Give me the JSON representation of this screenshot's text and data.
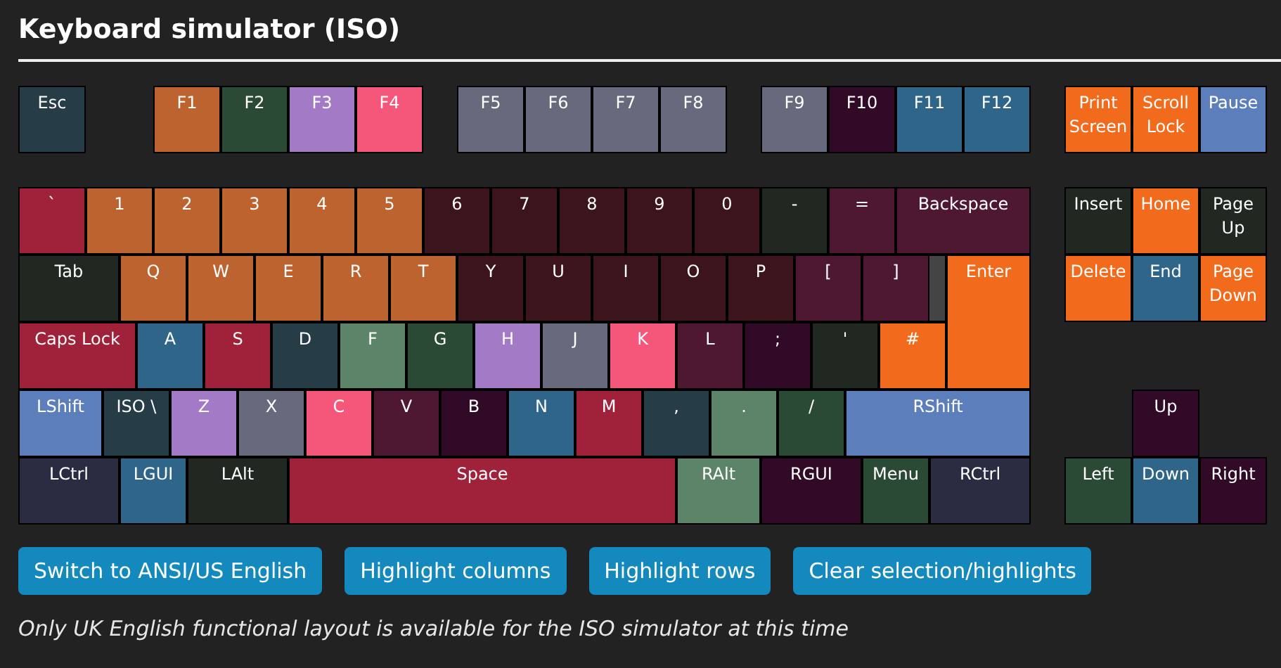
{
  "title": "Keyboard simulator (ISO)",
  "function_keys": [
    {
      "label": "Esc",
      "color": "#263c47"
    },
    {
      "label": "F1",
      "color": "#bc6330"
    },
    {
      "label": "F2",
      "color": "#2b4a36"
    },
    {
      "label": "F3",
      "color": "#a27ac6"
    },
    {
      "label": "F4",
      "color": "#f5577b"
    },
    {
      "label": "F5",
      "color": "#666a7c"
    },
    {
      "label": "F6",
      "color": "#666a7c"
    },
    {
      "label": "F7",
      "color": "#666a7c"
    },
    {
      "label": "F8",
      "color": "#666a7c"
    },
    {
      "label": "F9",
      "color": "#666a7c"
    },
    {
      "label": "F10",
      "color": "#300a26"
    },
    {
      "label": "F11",
      "color": "#30658a"
    },
    {
      "label": "F12",
      "color": "#30658a"
    },
    {
      "label": "Print Screen",
      "color": "#f26b1d"
    },
    {
      "label": "Scroll Lock",
      "color": "#f26b1d"
    },
    {
      "label": "Pause",
      "color": "#5c7fbb"
    }
  ],
  "main_rows": [
    [
      {
        "label": "`",
        "color": "#a0213a"
      },
      {
        "label": "1",
        "color": "#bc6330"
      },
      {
        "label": "2",
        "color": "#bc6330"
      },
      {
        "label": "3",
        "color": "#bc6330"
      },
      {
        "label": "4",
        "color": "#bc6330"
      },
      {
        "label": "5",
        "color": "#bc6330"
      },
      {
        "label": "6",
        "color": "#3b151b"
      },
      {
        "label": "7",
        "color": "#3b151b"
      },
      {
        "label": "8",
        "color": "#3b151b"
      },
      {
        "label": "9",
        "color": "#3b151b"
      },
      {
        "label": "0",
        "color": "#3b151b"
      },
      {
        "label": "-",
        "color": "#212821"
      },
      {
        "label": "=",
        "color": "#4e1833"
      },
      {
        "label": "Backspace",
        "color": "#4e1833"
      }
    ],
    [
      {
        "label": "Tab",
        "color": "#212821"
      },
      {
        "label": "Q",
        "color": "#bc6330"
      },
      {
        "label": "W",
        "color": "#bc6330"
      },
      {
        "label": "E",
        "color": "#bc6330"
      },
      {
        "label": "R",
        "color": "#bc6330"
      },
      {
        "label": "T",
        "color": "#bc6330"
      },
      {
        "label": "Y",
        "color": "#3b151b"
      },
      {
        "label": "U",
        "color": "#3b151b"
      },
      {
        "label": "I",
        "color": "#3b151b"
      },
      {
        "label": "O",
        "color": "#3b151b"
      },
      {
        "label": "P",
        "color": "#3b151b"
      },
      {
        "label": "[",
        "color": "#4e1833"
      },
      {
        "label": "]",
        "color": "#4e1833"
      },
      {
        "label": "Enter",
        "color": "#f26b1d"
      }
    ],
    [
      {
        "label": "Caps Lock",
        "color": "#a0213a"
      },
      {
        "label": "A",
        "color": "#30658a"
      },
      {
        "label": "S",
        "color": "#a0213a"
      },
      {
        "label": "D",
        "color": "#263c47"
      },
      {
        "label": "F",
        "color": "#5b8468"
      },
      {
        "label": "G",
        "color": "#2b4a36"
      },
      {
        "label": "H",
        "color": "#a27ac6"
      },
      {
        "label": "J",
        "color": "#666a7c"
      },
      {
        "label": "K",
        "color": "#f5577b"
      },
      {
        "label": "L",
        "color": "#4e1833"
      },
      {
        "label": ";",
        "color": "#300a26"
      },
      {
        "label": "'",
        "color": "#212821"
      },
      {
        "label": "#",
        "color": "#f26b1d"
      }
    ],
    [
      {
        "label": "LShift",
        "color": "#5c7fbb"
      },
      {
        "label": "ISO \\",
        "color": "#263c47"
      },
      {
        "label": "Z",
        "color": "#a27ac6"
      },
      {
        "label": "X",
        "color": "#666a7c"
      },
      {
        "label": "C",
        "color": "#f5577b"
      },
      {
        "label": "V",
        "color": "#4e1833"
      },
      {
        "label": "B",
        "color": "#300a26"
      },
      {
        "label": "N",
        "color": "#30658a"
      },
      {
        "label": "M",
        "color": "#a0213a"
      },
      {
        "label": ",",
        "color": "#263c47"
      },
      {
        "label": ".",
        "color": "#5b8468"
      },
      {
        "label": "/",
        "color": "#2b4a36"
      },
      {
        "label": "RShift",
        "color": "#5c7fbb"
      }
    ],
    [
      {
        "label": "LCtrl",
        "color": "#2a2d42"
      },
      {
        "label": "LGUI",
        "color": "#30658a"
      },
      {
        "label": "LAlt",
        "color": "#212821"
      },
      {
        "label": "Space",
        "color": "#a0213a"
      },
      {
        "label": "RAlt",
        "color": "#5b8468"
      },
      {
        "label": "RGUI",
        "color": "#300a26"
      },
      {
        "label": "Menu",
        "color": "#2b4a36"
      },
      {
        "label": "RCtrl",
        "color": "#2a2d42"
      }
    ]
  ],
  "nav_keys": [
    {
      "label": "Insert",
      "color": "#212821"
    },
    {
      "label": "Home",
      "color": "#f26b1d"
    },
    {
      "label": "Page Up",
      "color": "#212821"
    },
    {
      "label": "Delete",
      "color": "#f26b1d"
    },
    {
      "label": "End",
      "color": "#30658a"
    },
    {
      "label": "Page Down",
      "color": "#f26b1d"
    }
  ],
  "arrow_keys": [
    {
      "label": "Up",
      "color": "#300a26"
    },
    {
      "label": "Left",
      "color": "#2b4a36"
    },
    {
      "label": "Down",
      "color": "#30658a"
    },
    {
      "label": "Right",
      "color": "#300a26"
    }
  ],
  "buttons": [
    "Switch to ANSI/US English",
    "Highlight columns",
    "Highlight rows",
    "Clear selection/highlights"
  ],
  "note": "Only UK English functional layout is available for the ISO simulator at this time"
}
